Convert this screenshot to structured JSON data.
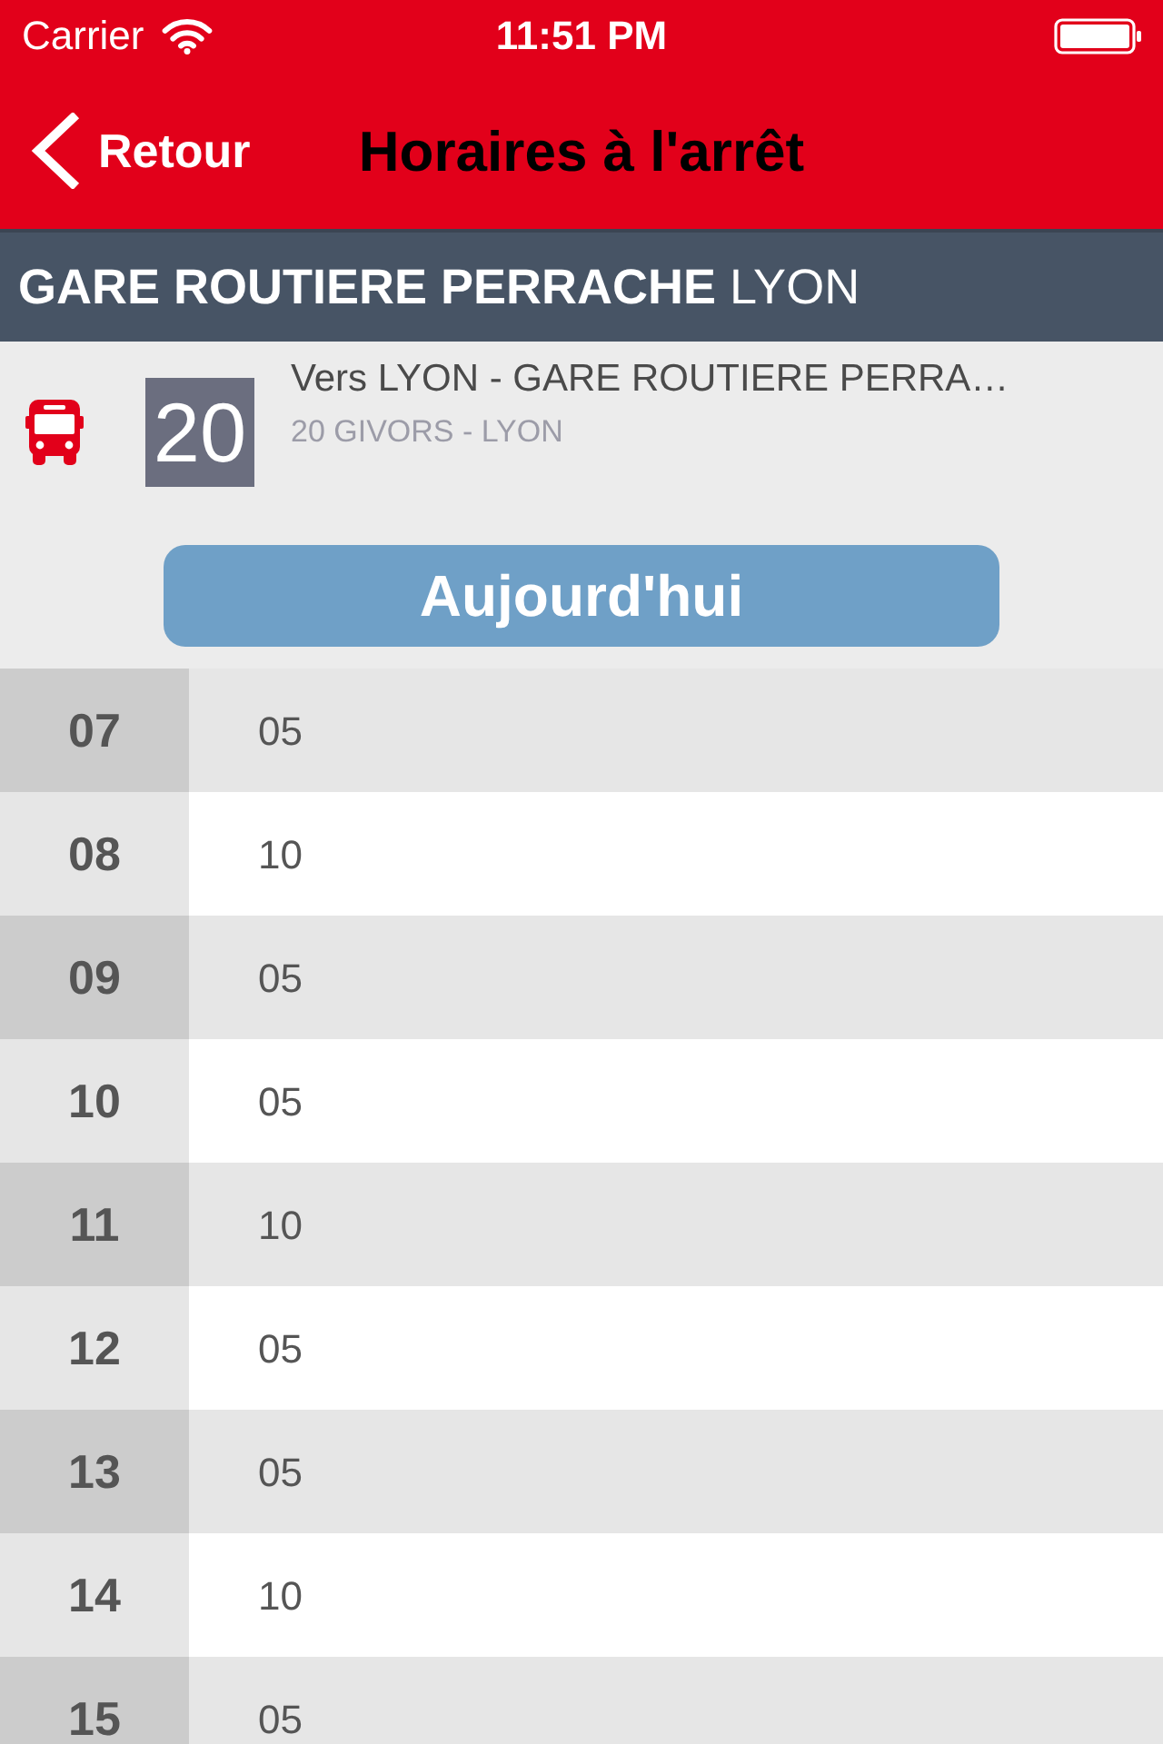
{
  "status_bar": {
    "carrier": "Carrier",
    "time": "11:51 PM"
  },
  "nav_bar": {
    "back_label": "Retour",
    "title": "Horaires à l'arrêt"
  },
  "stop": {
    "name": "**GARE ROUTIERE PERRACHE** LYON"
  },
  "line": {
    "number": "20",
    "direction": "Vers LYON - GARE ROUTIERE PERRA…",
    "name": "20 GIVORS - LYON"
  },
  "day_button": {
    "label": "Aujourd'hui"
  },
  "timetable": {
    "rows": [
      {
        "hour": "07",
        "minutes": [
          "05"
        ]
      },
      {
        "hour": "08",
        "minutes": [
          "10"
        ]
      },
      {
        "hour": "09",
        "minutes": [
          "05"
        ]
      },
      {
        "hour": "10",
        "minutes": [
          "05"
        ]
      },
      {
        "hour": "11",
        "minutes": [
          "10"
        ]
      },
      {
        "hour": "12",
        "minutes": [
          "05"
        ]
      },
      {
        "hour": "13",
        "minutes": [
          "05"
        ]
      },
      {
        "hour": "14",
        "minutes": [
          "10"
        ]
      },
      {
        "hour": "15",
        "minutes": [
          "05"
        ]
      }
    ]
  }
}
